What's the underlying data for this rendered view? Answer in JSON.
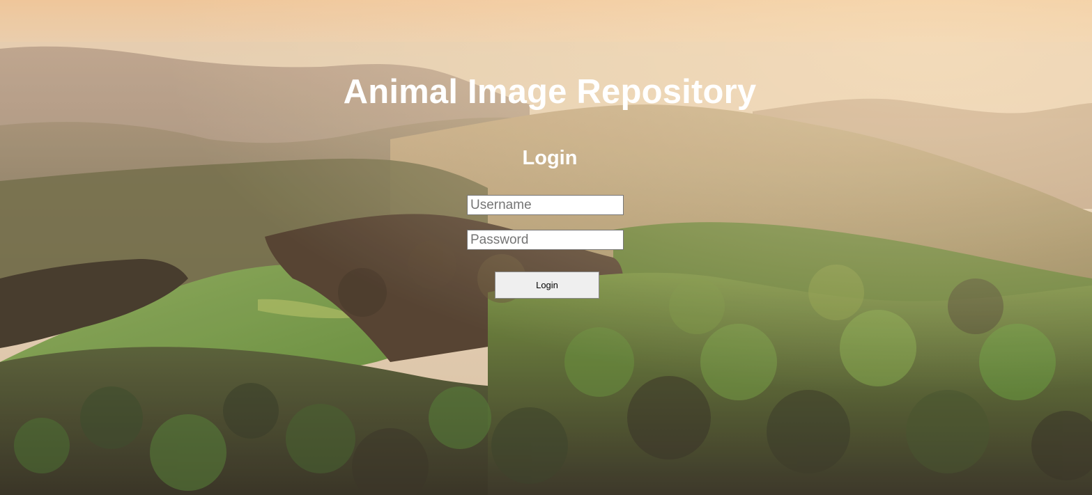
{
  "page": {
    "title": "Animal Image Repository",
    "login_heading": "Login"
  },
  "form": {
    "username": {
      "value": "",
      "placeholder": "Username"
    },
    "password": {
      "value": "",
      "placeholder": "Password"
    },
    "submit_label": "Login"
  },
  "colors": {
    "heading_text": "#ffffff",
    "sky_top": "#f0caa0",
    "sky_haze": "#e9d6bd",
    "far_hills": "#a38f80",
    "mid_hills": "#8a7a5e",
    "meadow": "#6f9a45",
    "forest_light": "#5f8c3a",
    "forest_dark": "#2c2a20",
    "button_bg": "#efefef"
  },
  "background": {
    "description_icon": "landscape-hills-forest-image"
  }
}
